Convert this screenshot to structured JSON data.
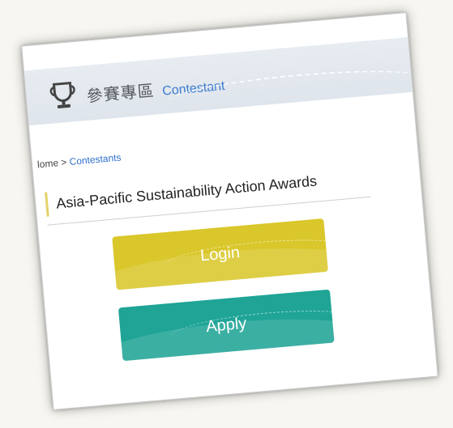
{
  "header": {
    "title_zh": "參賽專區",
    "title_en": "Contestant",
    "icon": "trophy-icon"
  },
  "breadcrumb": {
    "home": "lome",
    "separator": " > ",
    "current": "Contestants"
  },
  "section": {
    "title": "Asia-Pacific Sustainability Action Awards"
  },
  "buttons": {
    "login_label": "Login",
    "apply_label": "Apply"
  },
  "colors": {
    "login_bg": "#d9c72b",
    "apply_bg": "#1fa496",
    "link": "#2f6fcc",
    "accent_bar": "#e3d36a"
  }
}
